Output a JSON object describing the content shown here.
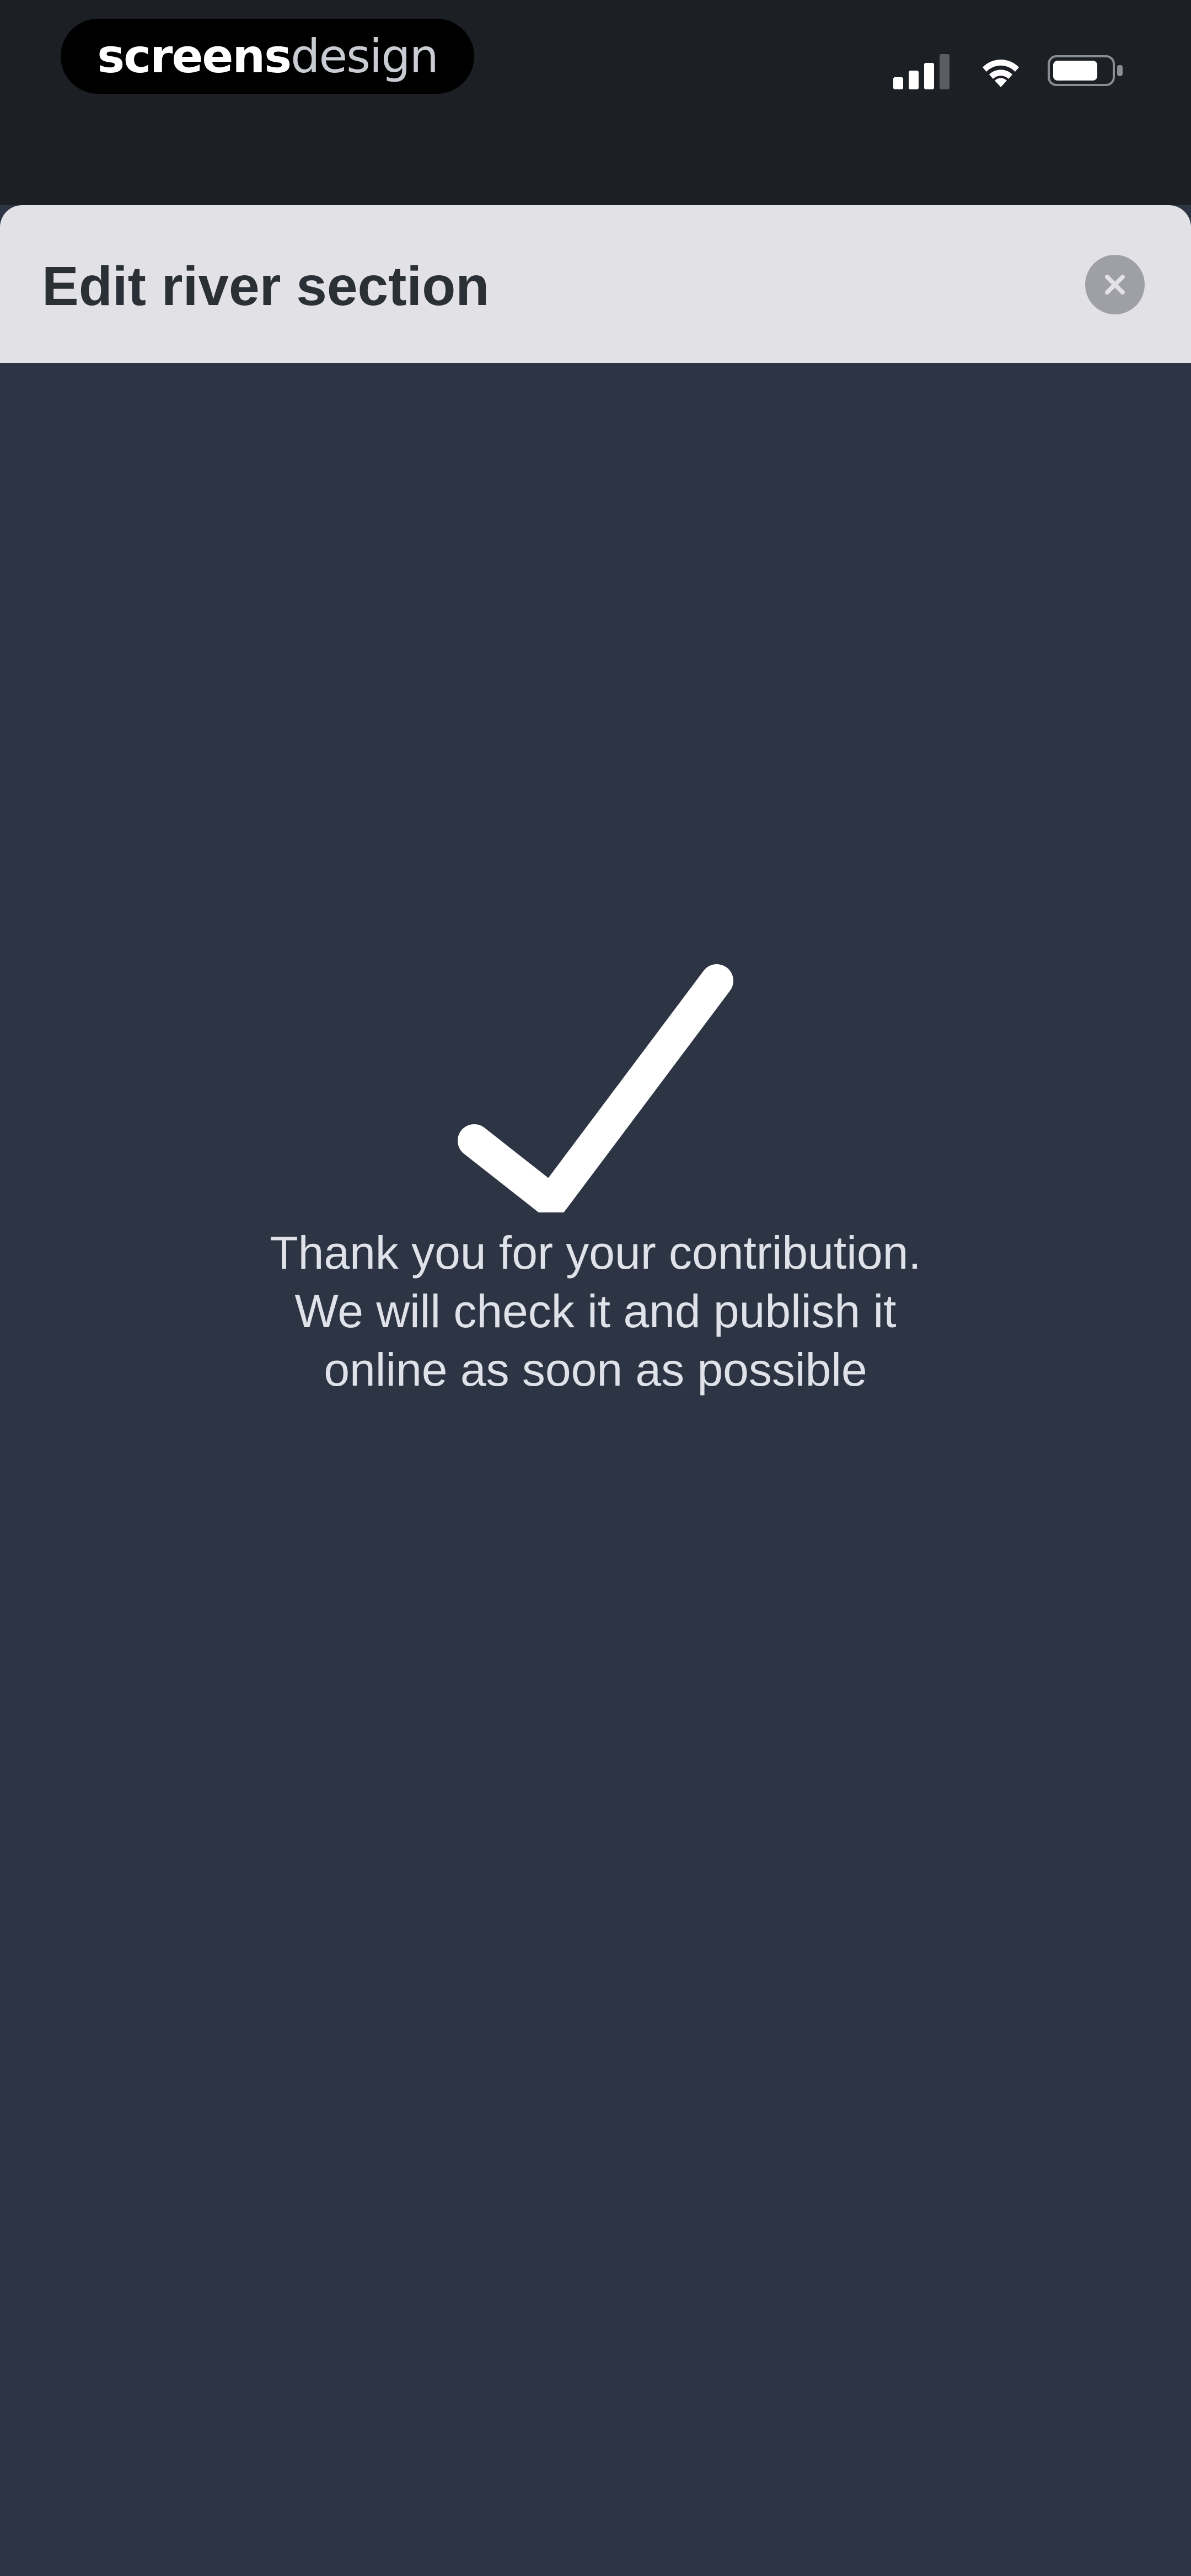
{
  "status_bar": {
    "brand_part1": "screens",
    "brand_part2": "design",
    "icons": [
      "signal-icon",
      "wifi-icon",
      "battery-icon"
    ]
  },
  "header": {
    "title": "Edit river section",
    "close_icon": "close-icon"
  },
  "confirmation": {
    "icon": "checkmark-icon",
    "lines": [
      "Thank you for your contribution.",
      "We will check it and publish it",
      "online as soon as possible"
    ]
  },
  "colors": {
    "status_bar_bg": "#1c1f24",
    "header_bg": "#e2e2e6",
    "content_bg": "#2d3545",
    "text_light": "#dfe2e8",
    "title_text": "#2b2f36",
    "close_button": "#9ea0a6"
  }
}
